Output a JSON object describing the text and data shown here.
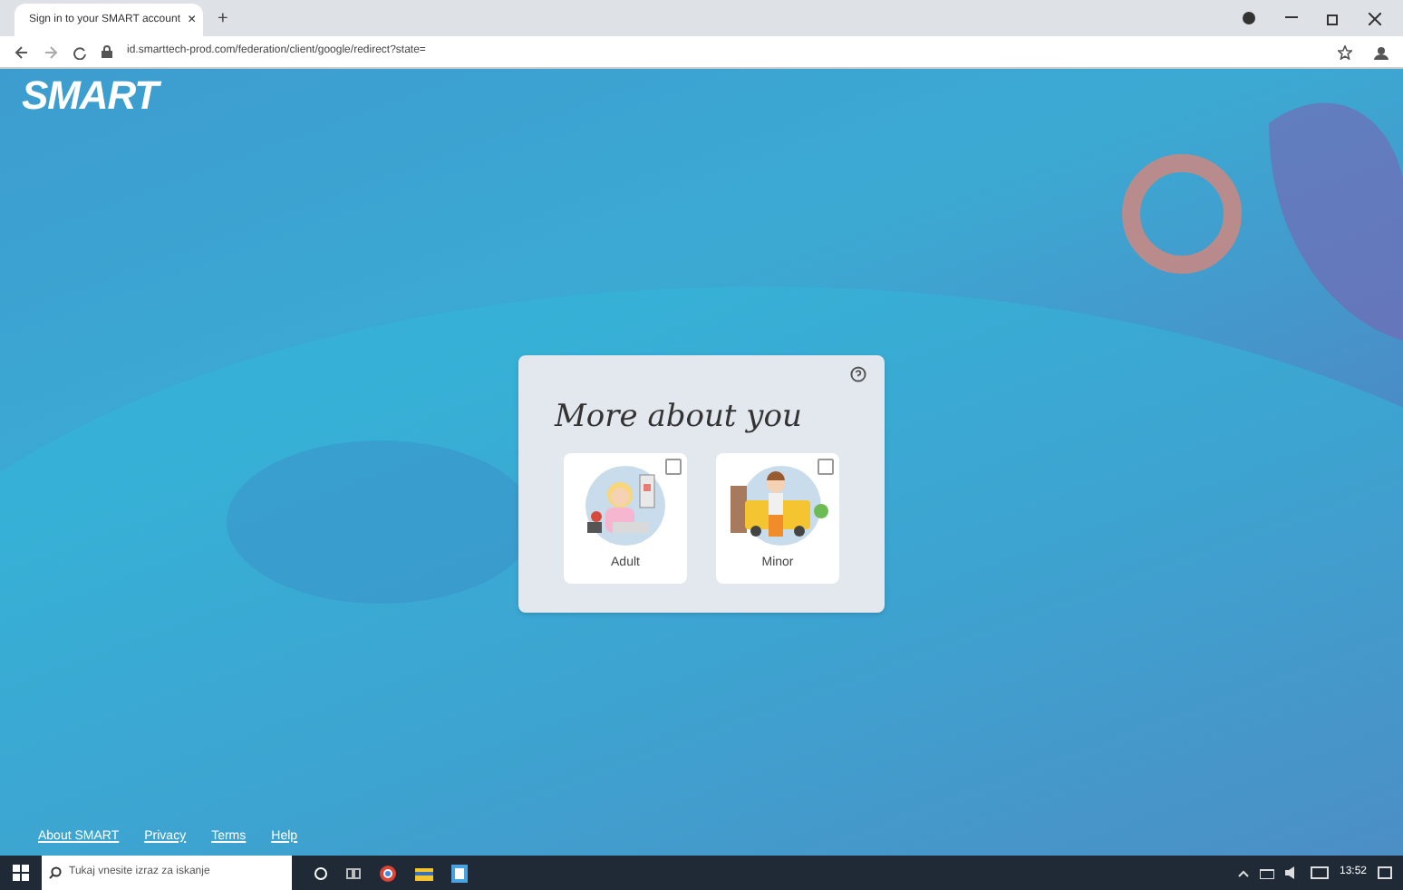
{
  "browser": {
    "tab_title": "Sign in to your SMART account",
    "tab_close": "×",
    "new_tab": "+",
    "url": "id.smarttech-prod.com/federation/client/google/redirect?state="
  },
  "logo": "SMART",
  "dialog": {
    "title": "More about you",
    "options": [
      {
        "label": "Adult",
        "kind": "adult",
        "checked": false
      },
      {
        "label": "Minor",
        "kind": "minor",
        "checked": false
      }
    ]
  },
  "footer_links": [
    "About SMART",
    "Privacy",
    "Terms",
    "Help"
  ],
  "taskbar": {
    "search_placeholder": "Tukaj vnesite izraz za iskanje",
    "time": "13:52"
  }
}
